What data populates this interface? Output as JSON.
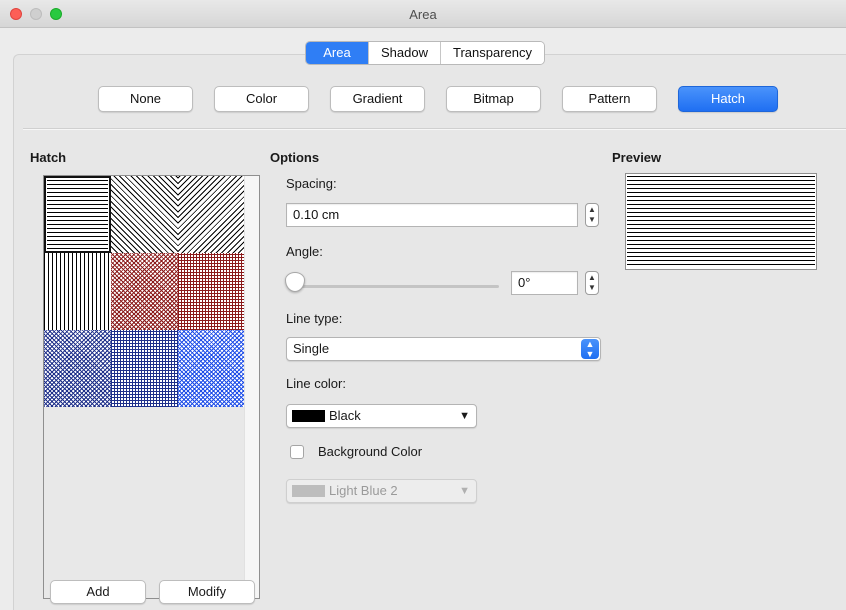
{
  "window": {
    "title": "Area"
  },
  "tabs": [
    {
      "label": "Area",
      "active": true
    },
    {
      "label": "Shadow",
      "active": false
    },
    {
      "label": "Transparency",
      "active": false
    }
  ],
  "fill_types": [
    {
      "label": "None",
      "active": false
    },
    {
      "label": "Color",
      "active": false
    },
    {
      "label": "Gradient",
      "active": false
    },
    {
      "label": "Bitmap",
      "active": false
    },
    {
      "label": "Pattern",
      "active": false
    },
    {
      "label": "Hatch",
      "active": true
    }
  ],
  "hatch": {
    "title": "Hatch",
    "swatches": [
      {
        "style": "horizontal-lines",
        "color": "#000000",
        "selected": true
      },
      {
        "style": "diagonal-lines",
        "color": "#000000",
        "selected": false
      },
      {
        "style": "diagonal-lines-reverse",
        "color": "#000000",
        "selected": false
      },
      {
        "style": "vertical-lines",
        "color": "#000000",
        "selected": false
      },
      {
        "style": "crossed-diagonal",
        "color": "#8b1a1a",
        "selected": false
      },
      {
        "style": "crossed-grid",
        "color": "#8b1a1a",
        "selected": false
      },
      {
        "style": "crossed-diagonal",
        "color": "#1e2f8a",
        "selected": false
      },
      {
        "style": "crossed-grid",
        "color": "#1e2f8a",
        "selected": false
      },
      {
        "style": "crossed-diagonal",
        "color": "#1e4de8",
        "selected": false
      }
    ],
    "add_label": "Add",
    "modify_label": "Modify"
  },
  "options": {
    "title": "Options",
    "spacing_label": "Spacing:",
    "spacing_value": "0.10 cm",
    "angle_label": "Angle:",
    "angle_value": "0°",
    "angle_slider_level": 0,
    "line_type_label": "Line type:",
    "line_type_value": "Single",
    "line_color_label": "Line color:",
    "line_color_value": "Black",
    "line_color_hex": "#000000",
    "background_color_label": "Background Color",
    "background_color_checked": false,
    "background_color_value": "Light Blue 2",
    "background_color_hex": "#bdbdbd"
  },
  "preview": {
    "title": "Preview"
  },
  "colors": {
    "accent": "#2f7ef5",
    "traffic_close": "#fd5f57",
    "traffic_max": "#28c940"
  }
}
